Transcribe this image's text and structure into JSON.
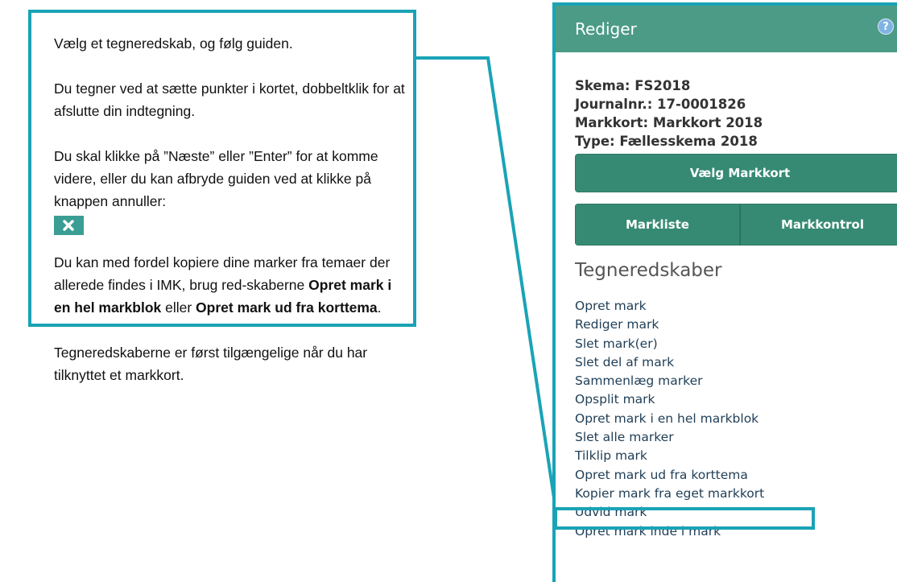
{
  "guide": {
    "p1": "Vælg et tegneredskab, og følg guiden.",
    "p2": "Du tegner ved at sætte punkter i kortet, dobbeltklik for at afslutte din indtegning.",
    "p3": "Du skal klikke på ”Næste” eller ”Enter” for at komme videre, eller du kan afbryde guiden ved at klikke på knappen annuller:",
    "p4_pre": "Du kan med fordel kopiere dine marker fra temaer der allerede findes i IMK, brug red-skaberne ",
    "p4_bold1": "Opret mark i en hel markblok",
    "p4_mid": " eller ",
    "p4_bold2": "Opret mark ud fra korttema",
    "p4_post": ".",
    "p5": "Tegneredskaberne er først tilgængelige når du har tilknyttet et markkort.",
    "cancel_icon": "close-icon"
  },
  "panel": {
    "title": "Rediger",
    "help_glyph": "?",
    "info": [
      "Skema: FS2018",
      "Journalnr.: 17-0001826",
      "Markkort: Markkort 2018",
      "Type: Fællesskema 2018"
    ],
    "select_button": "Vælg Markkort",
    "list_button": "Markliste",
    "control_button": "Markkontrol",
    "tools_title": "Tegneredskaber",
    "tools": [
      "Opret mark",
      "Rediger mark",
      "Slet mark(er)",
      "Slet del af mark",
      "Sammenlæg marker",
      "Opsplit mark",
      "Opret mark i en hel markblok",
      "Slet alle marker",
      "Tilklip mark",
      "Opret mark ud fra korttema",
      "Kopier mark fra eget markkort",
      "Udvid mark",
      "Opret mark inde i mark"
    ]
  },
  "colors": {
    "accent": "#1aa3b6",
    "header": "#4c9b86",
    "button": "#368a73",
    "link": "#1f3e56"
  }
}
